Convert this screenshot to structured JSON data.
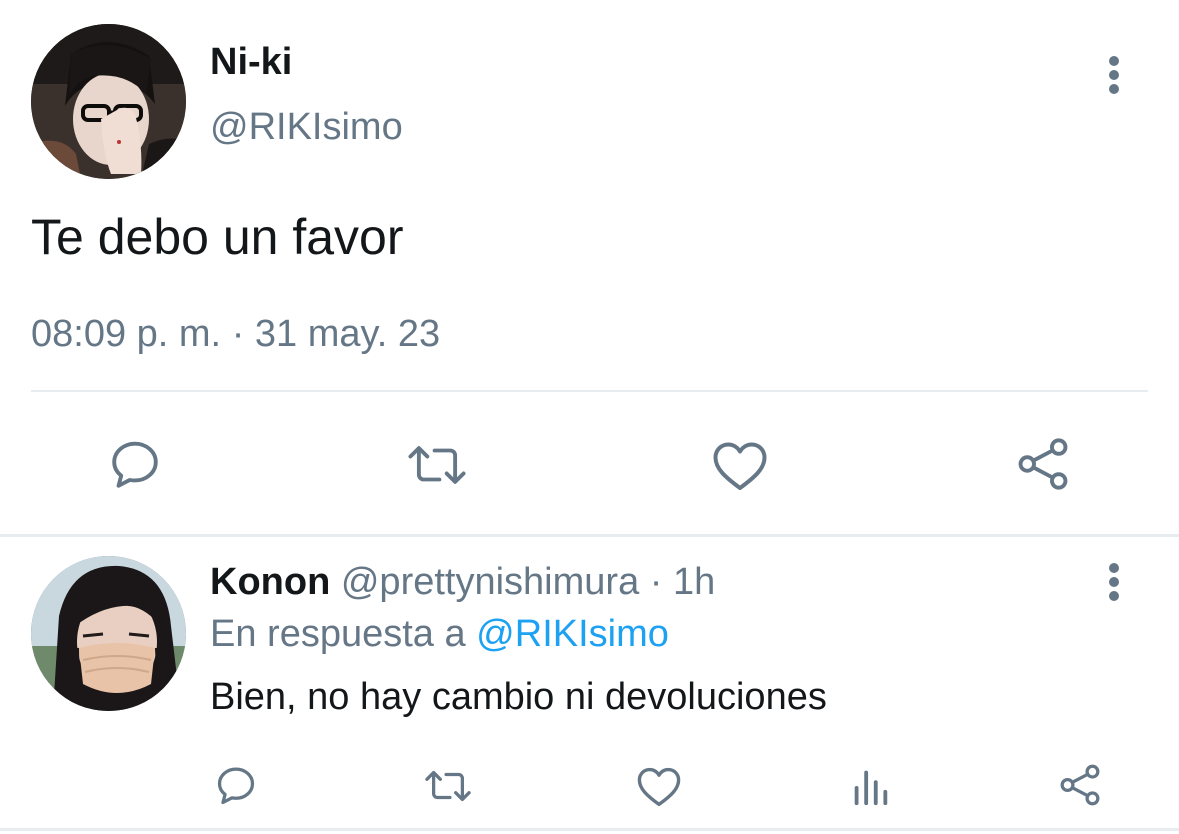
{
  "main_tweet": {
    "author_name": "Ni-ki",
    "author_handle": "@RIKIsimo",
    "text": "Te debo un favor",
    "time": "08:09 p. m.",
    "separator": "·",
    "date": "31 may. 23",
    "actions": [
      "reply-icon",
      "retweet-icon",
      "like-icon",
      "share-icon"
    ]
  },
  "reply_tweet": {
    "author_name": "Konon",
    "author_handle": "@prettynishimura",
    "separator": "·",
    "time": "1h",
    "reply_to_prefix": "En respuesta a",
    "reply_to_handle": "@RIKIsimo",
    "text": "Bien, no hay cambio ni devoluciones",
    "actions": [
      "reply-icon",
      "retweet-icon",
      "like-icon",
      "analytics-icon",
      "share-icon"
    ]
  },
  "colors": {
    "text_primary": "#14171a",
    "text_secondary": "#657786",
    "link": "#1da1f2",
    "divider": "#e6ecf0",
    "icon": "#657786"
  }
}
